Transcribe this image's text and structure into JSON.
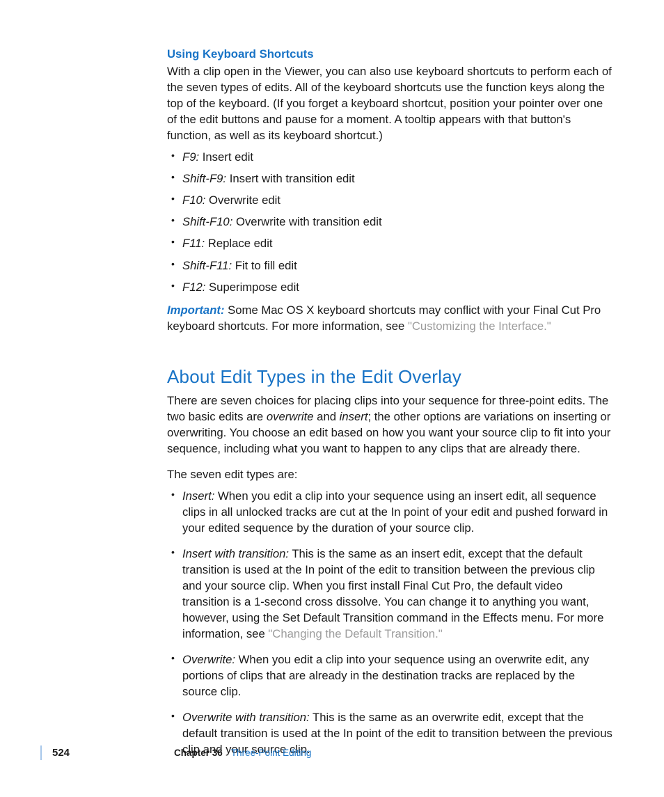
{
  "section1": {
    "heading": "Using Keyboard Shortcuts",
    "intro": "With a clip open in the Viewer, you can also use keyboard shortcuts to perform each of the seven types of edits. All of the keyboard shortcuts use the function keys along the top of the keyboard. (If you forget a keyboard shortcut, position your pointer over one of the edit buttons and pause for a moment. A tooltip appears with that button's function, as well as its keyboard shortcut.)",
    "shortcuts": [
      {
        "key": "F9:",
        "desc": " Insert edit"
      },
      {
        "key": "Shift-F9:",
        "desc": " Insert with transition edit"
      },
      {
        "key": "F10:",
        "desc": " Overwrite edit"
      },
      {
        "key": "Shift-F10:",
        "desc": " Overwrite with transition edit"
      },
      {
        "key": "F11:",
        "desc": " Replace edit"
      },
      {
        "key": "Shift-F11:",
        "desc": " Fit to fill edit"
      },
      {
        "key": "F12:",
        "desc": " Superimpose edit"
      }
    ],
    "important_label": "Important:  ",
    "important_text": "Some Mac OS X keyboard shortcuts may conflict with your Final Cut Pro keyboard shortcuts. For more information, see ",
    "important_link": "\"Customizing the Interface.\""
  },
  "section2": {
    "heading": "About Edit Types in the Edit Overlay",
    "p1_a": "There are seven choices for placing clips into your sequence for three-point edits. The two basic edits are ",
    "p1_ov": "overwrite",
    "p1_b": " and ",
    "p1_in": "insert",
    "p1_c": "; the other options are variations on inserting or overwriting. You choose an edit based on how you want your source clip to fit into your sequence, including what you want to happen to any clips that are already there.",
    "p2": "The seven edit types are:",
    "types": [
      {
        "term": "Insert:",
        "body": "  When you edit a clip into your sequence using an insert edit, all sequence clips in all unlocked tracks are cut at the In point of your edit and pushed forward in your edited sequence by the duration of your source clip.",
        "link": ""
      },
      {
        "term": "Insert with transition:",
        "body": "  This is the same as an insert edit, except that the default transition is used at the In point of the edit to transition between the previous clip and your source clip. When you first install Final Cut Pro, the default video transition is a 1-second cross dissolve. You can change it to anything you want, however, using the Set Default Transition command in the Effects menu. For more information, see ",
        "link": "\"Changing the Default Transition.\""
      },
      {
        "term": "Overwrite:",
        "body": "  When you edit a clip into your sequence using an overwrite edit, any portions of clips that are already in the destination tracks are replaced by the source clip.",
        "link": ""
      },
      {
        "term": "Overwrite with transition:",
        "body": "  This is the same as an overwrite edit, except that the default transition is used at the In point of the edit to transition between the previous clip and your source clip.",
        "link": ""
      }
    ]
  },
  "footer": {
    "page": "524",
    "chapter_label": "Chapter 36",
    "chapter_title": "Three-Point Editing"
  }
}
